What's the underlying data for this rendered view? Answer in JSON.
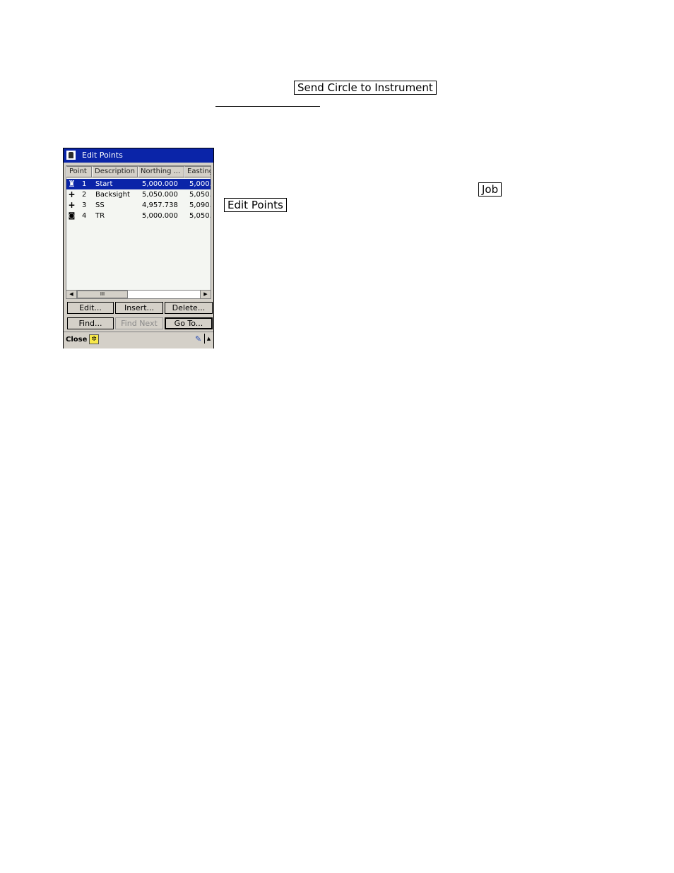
{
  "doc": {
    "send_circle_button": "Send Circle to Instrument",
    "job_button": "Job",
    "edit_points_button": "Edit Points"
  },
  "window": {
    "title": "Edit Points",
    "columns": [
      "Point",
      "Description",
      "Northing ...",
      "Easting"
    ],
    "rows": [
      {
        "icon": "instrument-icon",
        "point": "1",
        "description": "Start",
        "northing": "5,000.000",
        "easting": "5,000.",
        "selected": true
      },
      {
        "icon": "cross-icon",
        "point": "2",
        "description": "Backsight",
        "northing": "5,050.000",
        "easting": "5,050.",
        "selected": false
      },
      {
        "icon": "cross-icon",
        "point": "3",
        "description": "SS",
        "northing": "4,957.738",
        "easting": "5,090.",
        "selected": false
      },
      {
        "icon": "target-icon",
        "point": "4",
        "description": "TR",
        "northing": "5,000.000",
        "easting": "5,050.",
        "selected": false
      }
    ],
    "buttons": {
      "edit": "Edit...",
      "insert": "Insert...",
      "delete": "Delete...",
      "find": "Find...",
      "find_next": "Find Next",
      "go_to": "Go To..."
    },
    "statusbar": {
      "close": "Close"
    }
  },
  "colors": {
    "titlebar": "#0a24a8",
    "selection": "#0a24a8",
    "window_bg": "#d4d0c8",
    "list_bg": "#f4f6f2"
  }
}
